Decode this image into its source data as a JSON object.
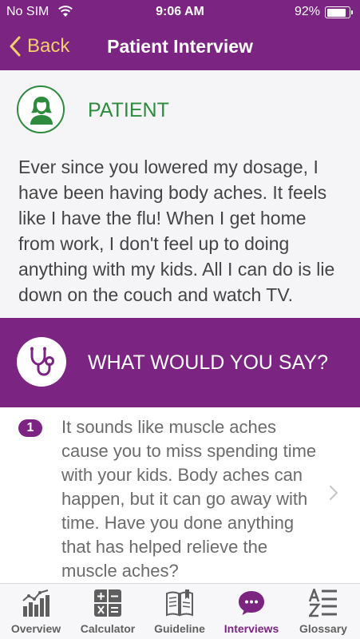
{
  "status_bar": {
    "carrier": "No SIM",
    "time": "9:06 AM",
    "battery_percent": "92%",
    "battery_level": 0.92
  },
  "nav_bar": {
    "back_label": "Back",
    "title": "Patient Interview",
    "back_color": "#f3cf6a"
  },
  "patient": {
    "label": "PATIENT",
    "icon": "patient-avatar-icon",
    "text": "Ever since you lowered my dosage, I have been having body aches. It feels like I have the flu! When I get home from work, I don't feel up to doing anything with my kids. All I can do is lie down on the couch and watch TV."
  },
  "question": {
    "label": "WHAT WOULD YOU SAY?",
    "icon": "stethoscope-icon"
  },
  "answers": [
    {
      "number": "1",
      "text": "It sounds like muscle aches cause you to miss spending time with your kids. Body aches can happen, but it can go away with time. Have you done anything that has helped relieve the muscle aches?"
    }
  ],
  "tabs": [
    {
      "label": "Overview",
      "icon": "bar-chart-icon",
      "active": false
    },
    {
      "label": "Calculator",
      "icon": "calculator-icon",
      "active": false
    },
    {
      "label": "Guideline",
      "icon": "book-icon",
      "active": false
    },
    {
      "label": "Interviews",
      "icon": "chat-bubble-icon",
      "active": true
    },
    {
      "label": "Glossary",
      "icon": "glossary-az-icon",
      "active": false
    }
  ],
  "colors": {
    "brand_purple": "#7b2482",
    "patient_green": "#2e8b3e",
    "accent_yellow": "#f3cf6a"
  }
}
